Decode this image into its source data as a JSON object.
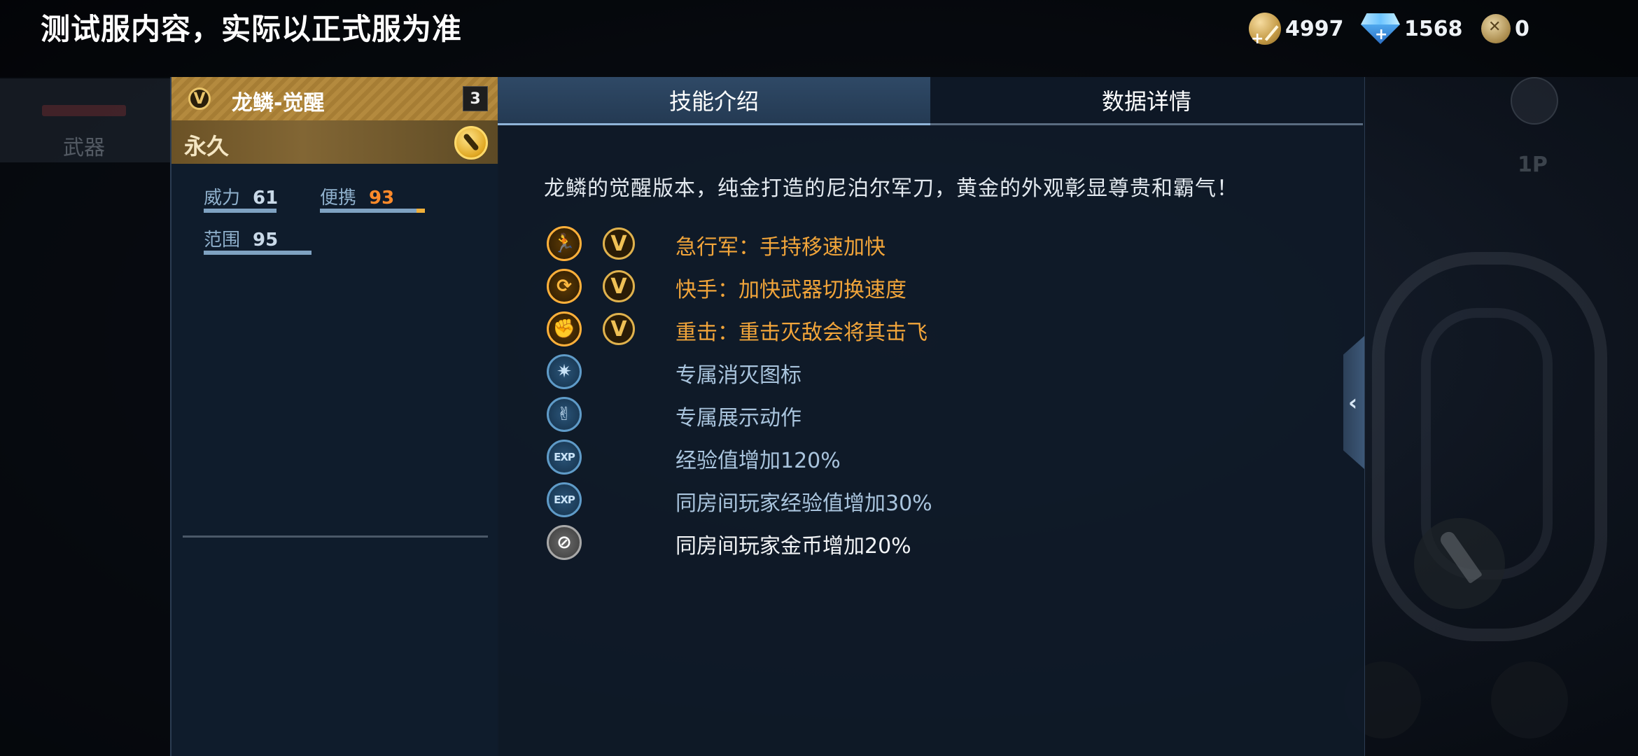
{
  "header": {
    "test_banner": "测试服内容，实际以正式服为准",
    "currencies": [
      {
        "icon": "gold-coin-icon",
        "amount": "4997"
      },
      {
        "icon": "diamond-icon",
        "amount": "1568"
      },
      {
        "icon": "token-icon",
        "amount": "0"
      }
    ]
  },
  "background": {
    "weapon_tab_label": "武器",
    "side_button_1p": "1P"
  },
  "item_card": {
    "title": "龙鳞-觉醒",
    "badge_letter": "V",
    "level": "3",
    "duration": "永久",
    "stats": [
      {
        "label": "威力",
        "value": "61",
        "value_color": "#c9d9e8",
        "fill": 0.61
      },
      {
        "label": "便携",
        "value": "93",
        "value_color": "#ff8a2a",
        "fill": 0.93
      },
      {
        "label": "范围",
        "value": "95",
        "value_color": "#c9d9e8",
        "fill": 0.95
      }
    ]
  },
  "detail_panel": {
    "tabs": [
      {
        "label": "技能介绍",
        "active": true
      },
      {
        "label": "数据详情",
        "active": false
      }
    ],
    "description": "龙鳞的觉醒版本，纯金打造的尼泊尔军刀，黄金的外观彰显尊贵和霸气！",
    "skills": [
      {
        "icon": "sprint-icon",
        "style": "gold",
        "glyph": "🏃",
        "has_v": true,
        "text": "急行军：手持移速加快",
        "text_style": "gold"
      },
      {
        "icon": "quick-swap-icon",
        "style": "gold",
        "glyph": "⟳",
        "has_v": true,
        "text": "快手：加快武器切换速度",
        "text_style": "gold"
      },
      {
        "icon": "heavy-hit-icon",
        "style": "gold",
        "glyph": "✊",
        "has_v": true,
        "text": "重击：重击灭敌会将其击飞",
        "text_style": "gold"
      },
      {
        "icon": "kill-mark-icon",
        "style": "blue",
        "glyph": "✷",
        "has_v": false,
        "text": "专属消灭图标",
        "text_style": "blue"
      },
      {
        "icon": "pose-icon",
        "style": "blue",
        "glyph": "✌",
        "has_v": false,
        "text": "专属展示动作",
        "text_style": "blue"
      },
      {
        "icon": "exp-icon",
        "style": "blue",
        "glyph": "EXP",
        "has_v": false,
        "text": "经验值增加120%",
        "text_style": "blue"
      },
      {
        "icon": "room-exp-icon",
        "style": "blue",
        "glyph": "EXP",
        "has_v": false,
        "text": "同房间玩家经验值增加30%",
        "text_style": "blue"
      },
      {
        "icon": "room-gold-icon",
        "style": "grey",
        "glyph": "⊘",
        "has_v": false,
        "text": "同房间玩家金币增加20%",
        "text_style": "white"
      }
    ],
    "collapse_arrow": "‹"
  }
}
